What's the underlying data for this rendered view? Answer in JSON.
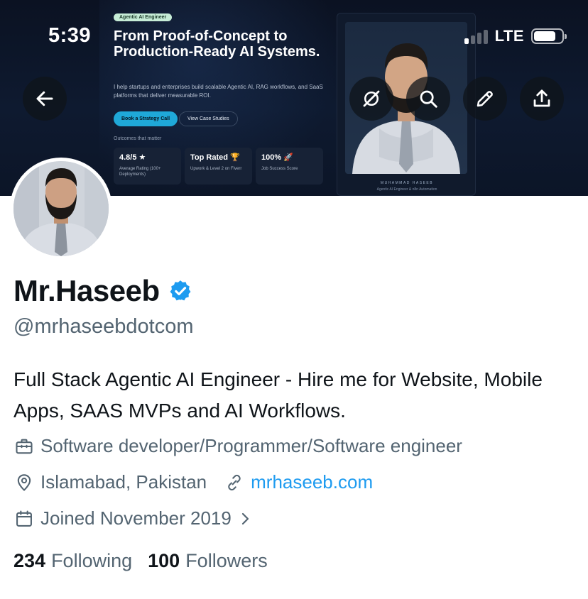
{
  "status_bar": {
    "time": "5:39",
    "network": "LTE"
  },
  "banner": {
    "badge": "Agentic AI Engineer",
    "title": "From Proof-of-Concept to Production-Ready AI Systems.",
    "subtitle": "I help startups and enterprises build scalable Agentic AI, RAG workflows, and SaaS platforms that deliver measurable ROI.",
    "primary_button": "Book a Strategy Call",
    "secondary_button": "View Case Studies",
    "outcomes_label": "Outcomes that matter",
    "stats": [
      {
        "value": "4.8/5 ★",
        "label": "Average Rating (100+ Deployments)"
      },
      {
        "value": "Top Rated 🏆",
        "label": "Upwork & Level 2 on Fiverr"
      },
      {
        "value": "100% 🚀",
        "label": "Job Success Score"
      }
    ],
    "portrait_name": "MUHAMMAD HASEEB",
    "portrait_role": "Agentic AI Engineer & n8n Automation"
  },
  "header_actions": {
    "back_icon": "arrow-left-icon",
    "grok_icon": "grok-icon",
    "search_icon": "search-icon",
    "edit_icon": "pencil-icon",
    "share_icon": "share-icon"
  },
  "profile": {
    "display_name": "Mr.Haseeb",
    "verified_color": "#1d9bf0",
    "handle": "@mrhaseebdotcom",
    "bio": "Full Stack Agentic AI Engineer - Hire me for Website, Mobile Apps, SAAS MVPs and AI Workflows.",
    "category": "Software developer/Programmer/Software engineer",
    "location": "Islamabad, Pakistan",
    "website": "mrhaseeb.com",
    "joined": "Joined November 2019",
    "following_count": "234",
    "following_label": "Following",
    "followers_count": "100",
    "followers_label": "Followers"
  },
  "colors": {
    "accent": "#1d9bf0",
    "secondary_text": "#536471",
    "primary_text": "#0f1419",
    "banner_bg": "#0b1222"
  }
}
